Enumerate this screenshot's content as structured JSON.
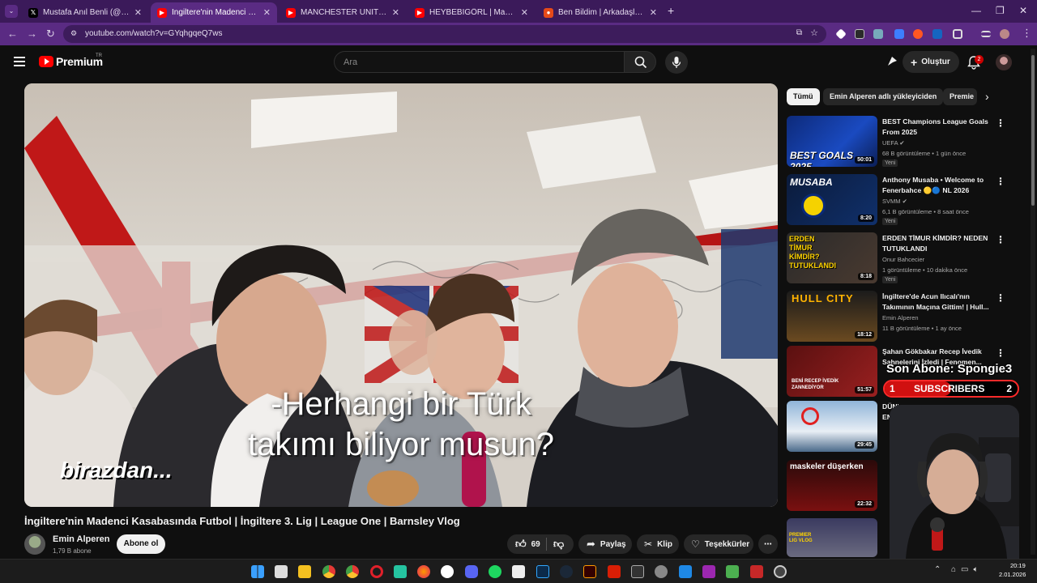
{
  "browser": {
    "tabs": [
      {
        "title": "Mustafa Anıl Benli (@fmbagimli",
        "favicon": "x-icon",
        "active": false
      },
      {
        "title": "İngiltere'nin Madenci Kasabası",
        "favicon": "youtube-icon",
        "active": true
      },
      {
        "title": "MANCHESTER UNITED NEDEN",
        "favicon": "youtube-icon",
        "active": false
      },
      {
        "title": "HEYBEBİGÖRL | Madara Olduk",
        "favicon": "youtube-icon",
        "active": false
      },
      {
        "title": "Ben Bildim | Arkadaşlarınla Onl",
        "favicon": "game-icon",
        "active": false
      }
    ],
    "new_tab": "+",
    "url": "youtube.com/watch?v=GYqhgqeQ7ws"
  },
  "header": {
    "brand": "Premium",
    "region": "TR",
    "search_placeholder": "Ara",
    "create_label": "Oluştur",
    "notification_count": "2"
  },
  "video": {
    "caption_line1": "-Herhangi bir Türk",
    "caption_line2": "takımı biliyor musun?",
    "soon_text": "birazdan...",
    "title": "İngiltere'nin Madenci Kasabasında Futbol | İngiltere 3. Lig | League One | Barnsley Vlog",
    "channel": "Emin Alperen",
    "subscribers": "1,79 B abone",
    "subscribe_label": "Abone ol",
    "likes": "69",
    "share_label": "Paylaş",
    "clip_label": "Klip",
    "thanks_label": "Teşekkürler"
  },
  "sidebar": {
    "chips": [
      "Tümü",
      "Emin Alperen adlı yükleyiciden",
      "Premie"
    ],
    "recommendations": [
      {
        "title": "BEST Champions League Goals From 2025",
        "channel": "UEFA",
        "verified": true,
        "meta": "68 B görüntüleme • 1 gün önce",
        "badge": "Yeni",
        "duration": "50:01",
        "thumb_text": "BEST GOALS 2025"
      },
      {
        "title": "Anthony Musaba • Welcome to Fenerbahce 🟡🔵 NL 2026",
        "channel": "SVMM",
        "verified": true,
        "meta": "6,1 B görüntüleme • 8 saat önce",
        "badge": "Yeni",
        "duration": "8:20",
        "thumb_text": "MUSABA"
      },
      {
        "title": "ERDEN TİMUR KİMDİR? NEDEN TUTUKLANDI",
        "channel": "Onur Bahcecier",
        "verified": false,
        "meta": "1 görüntüleme • 10 dakika önce",
        "badge": "Yeni",
        "duration": "8:18",
        "thumb_text": "ERDEN TİMUR KİMDİR? TUTUKLANDI"
      },
      {
        "title": "İngiltere'de Acun Ilıcalı'nın Takımının Maçına Gittim! | Hull...",
        "channel": "Emin Alperen",
        "verified": false,
        "meta": "11 B görüntüleme • 1 ay önce",
        "badge": "",
        "duration": "18:12",
        "thumb_text": "HULL CITY"
      },
      {
        "title": "Şahan Gökbakar Recep İvedik Sahnelerini İzledi | Fenomen...",
        "channel": "",
        "verified": false,
        "meta": "",
        "badge": "",
        "duration": "51:57",
        "thumb_text": "BENİ RECEP İVEDİK ZANNEDİYOR"
      },
      {
        "title": "DÜNYANIN EN YALNIZ EVİNDE...",
        "channel": "",
        "verified": false,
        "meta": "",
        "badge": "",
        "duration": "29:45",
        "thumb_text": ""
      },
      {
        "title": "",
        "channel": "",
        "verified": false,
        "meta": "",
        "badge": "",
        "duration": "22:32",
        "thumb_text": "maskeler düşerken"
      },
      {
        "title": "",
        "channel": "",
        "verified": false,
        "meta": "",
        "badge": "",
        "duration": "",
        "thumb_text": "PREMIER LIG VLOG"
      }
    ]
  },
  "overlay": {
    "last_sub_label": "Son Abone: Spongie3",
    "sub_current": "1",
    "sub_label": "SUBSCRIBERS",
    "sub_goal": "2",
    "progress_fraction": 0.5
  },
  "taskbar": {
    "time": "20:19",
    "date": "2.01.2026"
  },
  "colors": {
    "browser_frame": "#3b1a5a",
    "browser_active": "#5a2b83",
    "youtube_red": "#ff0000",
    "background": "#0f0f0f"
  }
}
